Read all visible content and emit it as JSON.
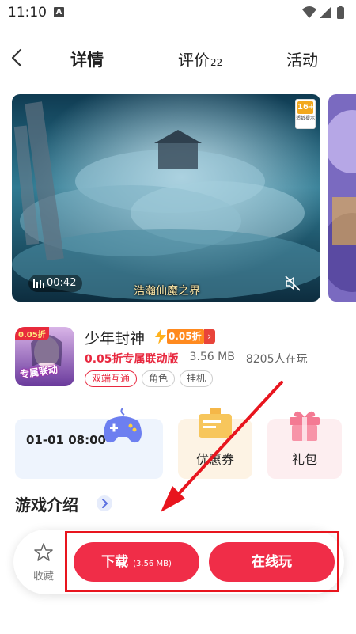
{
  "status_bar": {
    "time": "11:10",
    "notification": "A"
  },
  "nav": {
    "tabs": [
      {
        "label": "详情",
        "count": ""
      },
      {
        "label": "评价",
        "count": "22"
      },
      {
        "label": "活动",
        "count": ""
      }
    ],
    "active_tab": "详情"
  },
  "media": {
    "duration": "00:42",
    "caption": "浩瀚仙魔之界",
    "age_rating": "16+",
    "age_tip": "适龄提示"
  },
  "game": {
    "icon_tag": "0.05折",
    "icon_text": "专属联动",
    "name": "少年封神",
    "discount_badge": "0.05折",
    "promo_text": "0.05折专属联动版",
    "size": "3.56 MB",
    "players": "8205人在玩",
    "tags": [
      "双端互通",
      "角色",
      "挂机"
    ]
  },
  "cards": {
    "date": "01-01 08:00",
    "coupon_label": "优惠券",
    "gift_label": "礼包"
  },
  "intro": {
    "title": "游戏介绍"
  },
  "bottom_bar": {
    "favorite_label": "收藏",
    "download_label": "下载",
    "download_size": "(3.56 MB)",
    "play_label": "在线玩"
  },
  "colors": {
    "accent": "#f02d48",
    "annotation": "#e8151e",
    "discount_orange": "#ff8a1f"
  },
  "icons": [
    "back-arrow-icon",
    "wifi-icon",
    "signal-icon",
    "battery-icon",
    "bars-icon",
    "mute-icon",
    "bolt-icon",
    "gamepad-icon",
    "coupon-icon",
    "gift-icon",
    "chevron-right-icon",
    "star-icon"
  ]
}
